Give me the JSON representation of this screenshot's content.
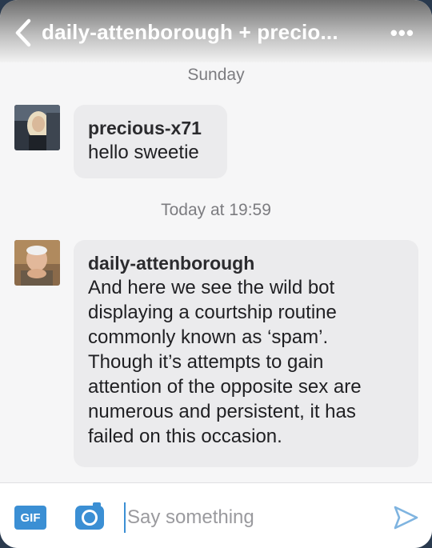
{
  "header": {
    "title": "daily-attenborough + precio...",
    "more_label": "•••"
  },
  "conversation": {
    "separators": [
      "Sunday",
      "Today at 19:59"
    ],
    "messages": [
      {
        "sender": "precious-x71",
        "lines": [
          "hello sweetie"
        ]
      },
      {
        "sender": "daily-attenborough",
        "lines": [
          "And here we see the wild bot",
          "displaying a courtship routine",
          "commonly known as ‘spam’.",
          "Though it’s attempts to gain",
          "attention of the opposite sex are",
          "numerous and persistent, it has",
          "failed on this occasion."
        ]
      }
    ]
  },
  "composer": {
    "gif_label": "GIF",
    "placeholder": "Say something"
  },
  "colors": {
    "accent": "#3b8fd4",
    "bubble": "#ebebed",
    "background": "#f6f6f7"
  },
  "icons": {
    "back": "chevron-left-icon",
    "more": "more-dots-icon",
    "camera": "camera-icon",
    "send": "send-icon"
  }
}
